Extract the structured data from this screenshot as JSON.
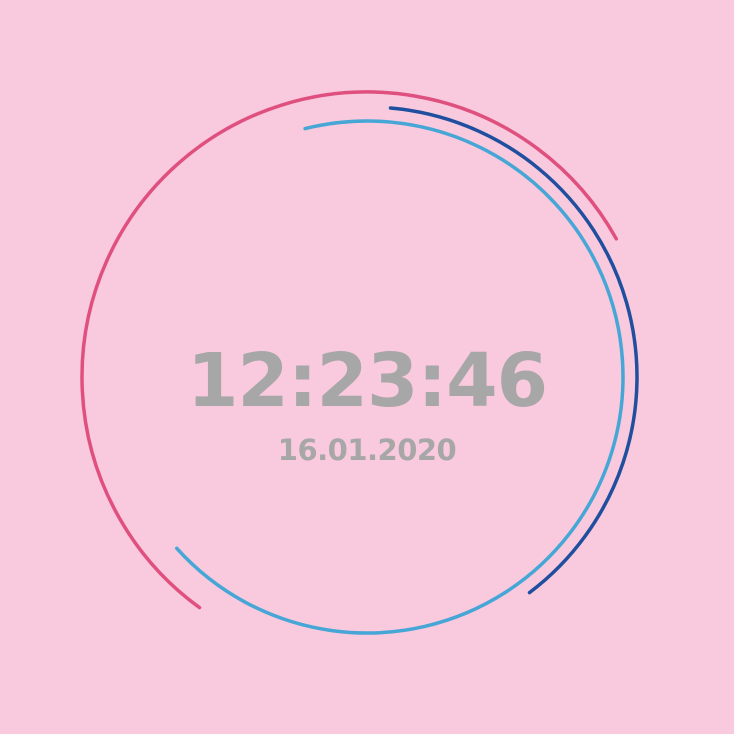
{
  "clock": {
    "time": "12:23:46",
    "date": "16.01.2020",
    "hours": 12,
    "minutes": 23,
    "seconds": 46
  },
  "colors": {
    "background": "#f9c9dd",
    "hour_ring": "#e0507f",
    "minute_ring": "#1f4f9e",
    "second_ring": "#46a6d6",
    "text": "#a7a7a7"
  }
}
